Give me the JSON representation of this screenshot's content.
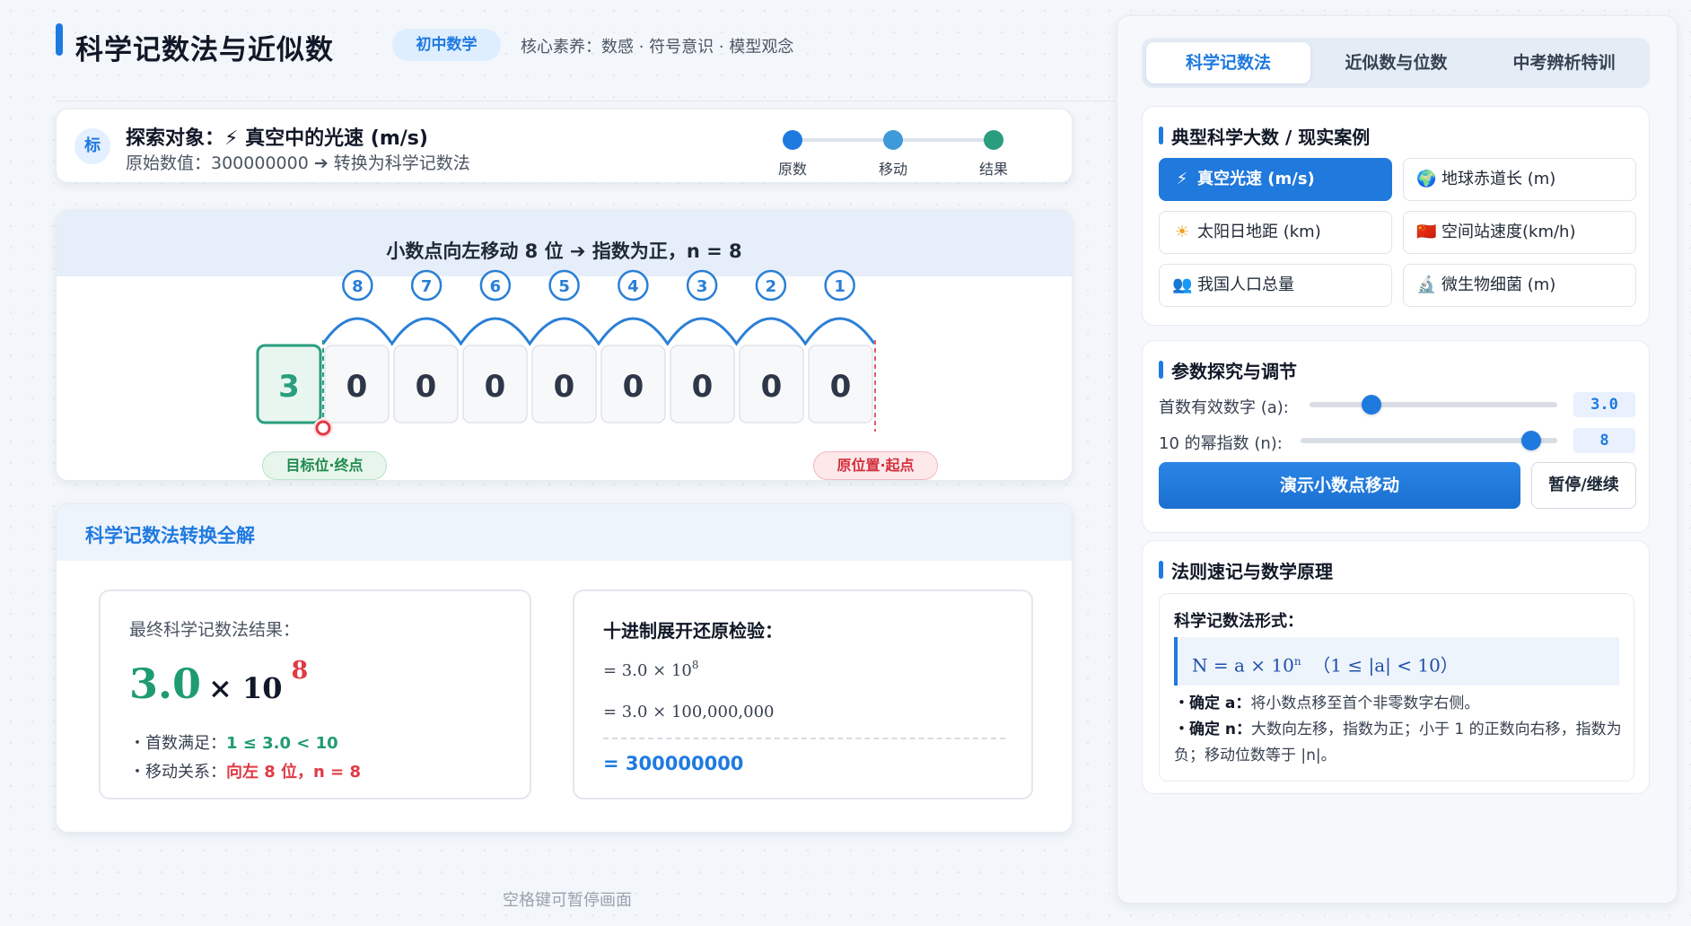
{
  "header": {
    "title": "科学记数法与近似数",
    "grade_badge": "初中数学",
    "core_literacy": "核心素养：数感 · 符号意识 · 模型观念"
  },
  "target": {
    "icon_text": "标",
    "title": "探索对象：⚡ 真空中的光速 (m/s)",
    "subtitle": "原始数值：300000000 ➔ 转换为科学记数法",
    "steps": [
      "原数",
      "移动",
      "结果"
    ]
  },
  "demo": {
    "title": "小数点向左移动 8 位 ➔ 指数为正，n = 8",
    "digits": [
      "3",
      "0",
      "0",
      "0",
      "0",
      "0",
      "0",
      "0",
      "0"
    ],
    "jump_labels": [
      "8",
      "7",
      "6",
      "5",
      "4",
      "3",
      "2",
      "1"
    ],
    "target_tag": "目标位·终点",
    "origin_tag": "原位置·起点"
  },
  "result": {
    "section_title": "科学记数法转换全解",
    "final_label": "最终科学记数法结果：",
    "formula_a": "3.0",
    "formula_x": "× 10",
    "formula_exp": "8",
    "check1_label": "・首数满足：",
    "check1_value": "1 ≤ 3.0 < 10",
    "check2_label": "・移动关系：",
    "check2_value": "向左 8 位，n = 8",
    "verify_title": "十进制展开还原检验：",
    "verify_line1": "= 3.0 × 10",
    "verify_line1_exp": "8",
    "verify_line2": "= 3.0 × 100,000,000",
    "verify_result": "= 300000000"
  },
  "hint": "空格键可暂停画面",
  "right_panel": {
    "tabs": [
      "科学记数法",
      "近似数与位数",
      "中考辨析特训"
    ],
    "cases_title": "典型科学大数 / 现实案例",
    "cases": [
      {
        "icon": "⚡",
        "label": "真空光速 (m/s)"
      },
      {
        "icon": "🌍",
        "label": "地球赤道长 (m)"
      },
      {
        "icon": "☀",
        "label": "太阳日地距 (km)"
      },
      {
        "icon": "🇨🇳",
        "label": "空间站速度(km/h)"
      },
      {
        "icon": "👥",
        "label": "我国人口总量"
      },
      {
        "icon": "🔬",
        "label": "微生物细菌 (m)"
      }
    ],
    "params_title": "参数探究与调节",
    "param_a_label": "首数有效数字 (a):",
    "param_a_value": "3.0",
    "param_a_fraction": 0.25,
    "param_n_label": "10 的幂指数 (n):",
    "param_n_value": "8",
    "param_n_fraction": 0.9,
    "demo_button": "演示小数点移动",
    "pause_button": "暂停/继续",
    "rules_title": "法则速记与数学原理",
    "rule_form_title": "科学记数法形式：",
    "rule_formula_main": "N = a × 10",
    "rule_formula_exp": "n",
    "rule_formula_cond": "（1 ≤ |a| < 10）",
    "rule1_label": "・确定 a：",
    "rule1_text": "将小数点移至首个非零数字右侧。",
    "rule2_label": "・确定 n：",
    "rule2_text": "大数向左移，指数为正；小于 1 的正数向右移，指数为负；移动位数等于 |n|。"
  },
  "colors": {
    "accent": "#1f7ae0",
    "green": "#1f9b74",
    "red": "#e03a45"
  }
}
